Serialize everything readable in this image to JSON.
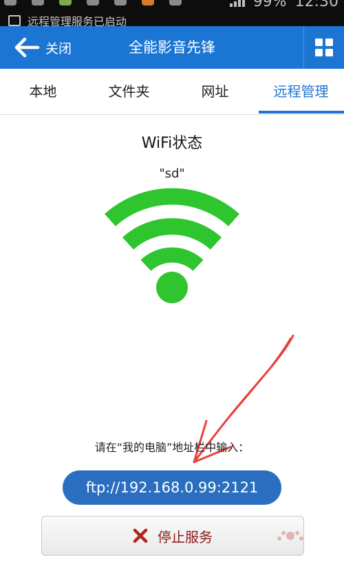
{
  "status_bar": {
    "notification": "远程管理服务已启动",
    "battery": "99%",
    "time": "12:30"
  },
  "title_bar": {
    "back_label": "关闭",
    "title": "全能影音先锋",
    "icons": {
      "back": "arrow-left-icon",
      "menu": "grid-icon"
    }
  },
  "tabs": [
    {
      "label": "本地",
      "active": false
    },
    {
      "label": "文件夹",
      "active": false
    },
    {
      "label": "网址",
      "active": false
    },
    {
      "label": "远程管理",
      "active": true
    }
  ],
  "wifi": {
    "title": "WiFi状态",
    "ssid": "\"sd\"",
    "icon": "wifi-icon",
    "color": "#2fc52f"
  },
  "instructions": {
    "hint": "请在“我的电脑”地址栏中输入：",
    "ftp_address": "ftp://192.168.0.99:2121"
  },
  "stop_button": {
    "label": "停止服务",
    "icon": "close-x-icon",
    "icon_color": "#b3231f"
  },
  "colors": {
    "primary": "#1b76d3",
    "pill": "#2a6fbf",
    "annotation_arrow": "#e8403a"
  }
}
